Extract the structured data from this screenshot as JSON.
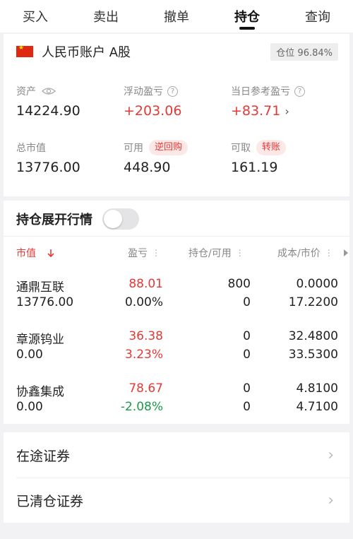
{
  "tabs": [
    {
      "label": "买入"
    },
    {
      "label": "卖出"
    },
    {
      "label": "撤单"
    },
    {
      "label": "持仓"
    },
    {
      "label": "查询"
    }
  ],
  "account": {
    "name": "人民币账户 A股",
    "position_badge": "仓位 96.84%",
    "metrics": {
      "assets_label": "资产",
      "assets_value": "14224.90",
      "float_pl_label": "浮动盈亏",
      "float_pl_value": "+203.06",
      "daily_pl_label": "当日参考盈亏",
      "daily_pl_value": "+83.71",
      "market_value_label": "总市值",
      "market_value_value": "13776.00",
      "available_label": "可用",
      "available_value": "448.90",
      "reverse_repo_label": "逆回购",
      "withdrawable_label": "可取",
      "withdrawable_value": "161.19",
      "transfer_label": "转账"
    }
  },
  "holdings": {
    "expand_label": "持仓展开行情",
    "toggle_on": false,
    "columns": {
      "market_value": "市值",
      "pl": "盈亏",
      "position": "持仓/可用",
      "cost_price": "成本/市价"
    },
    "rows": [
      {
        "name": "通鼎互联",
        "market_value": "13776.00",
        "pl": "88.01",
        "pl_pct": "0.00%",
        "position": "800",
        "available": "0",
        "cost": "0.0000",
        "price": "17.2200"
      },
      {
        "name": "章源钨业",
        "market_value": "0.00",
        "pl": "36.38",
        "pl_pct": "3.23%",
        "position": "0",
        "available": "0",
        "cost": "32.4800",
        "price": "33.5300"
      },
      {
        "name": "协鑫集成",
        "market_value": "0.00",
        "pl": "78.67",
        "pl_pct": "-2.08%",
        "position": "0",
        "available": "0",
        "cost": "4.8100",
        "price": "4.7100"
      }
    ]
  },
  "links": {
    "in_transit": "在途证券",
    "cleared": "已清仓证券"
  },
  "colors": {
    "red": "#e53935",
    "green": "#1a9a4a"
  }
}
